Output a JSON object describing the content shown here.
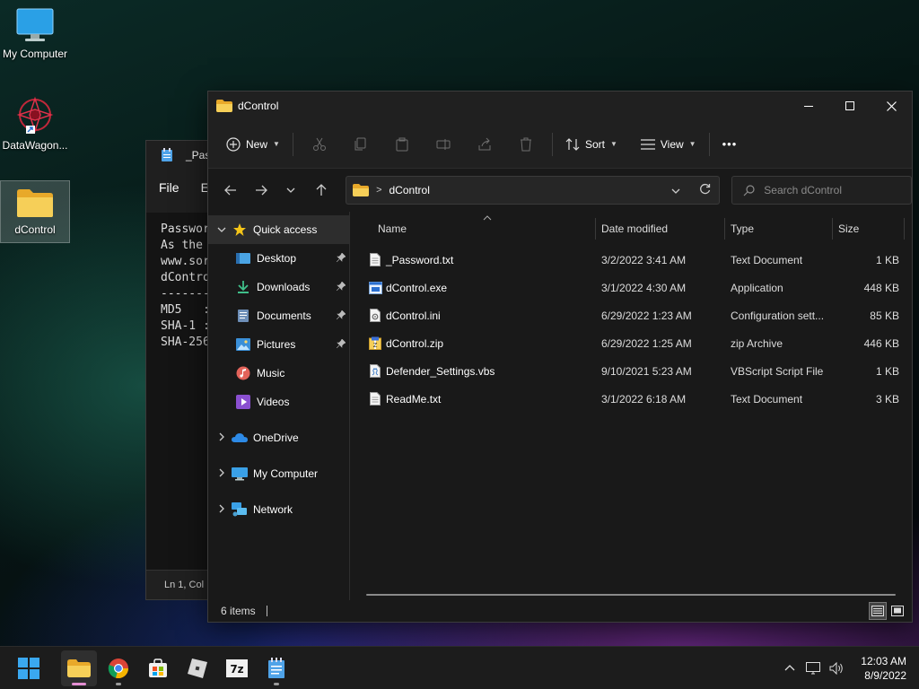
{
  "desktop": {
    "icons": [
      {
        "label": "My Computer"
      },
      {
        "label": "DataWagon..."
      },
      {
        "label": "dControl"
      }
    ]
  },
  "notepad": {
    "title": "_Pas",
    "menu_file": "File",
    "menu_edit": "E",
    "text_lines": [
      "Passwor",
      "",
      "As the ",
      "",
      "www.sor",
      "",
      "dContro",
      "-------",
      "MD5   :",
      "SHA-1 :",
      "SHA-256"
    ],
    "status": "Ln 1, Col"
  },
  "explorer": {
    "title": "dControl",
    "toolbar": {
      "new_label": "New",
      "sort_label": "Sort",
      "view_label": "View",
      "more_label": "•••"
    },
    "address": {
      "folder": "dControl"
    },
    "search": {
      "placeholder": "Search dControl"
    },
    "nav": {
      "quick_access": "Quick access",
      "pinned": [
        {
          "label": "Desktop"
        },
        {
          "label": "Downloads"
        },
        {
          "label": "Documents"
        },
        {
          "label": "Pictures"
        },
        {
          "label": "Music"
        },
        {
          "label": "Videos"
        }
      ],
      "onedrive": "OneDrive",
      "my_computer": "My Computer",
      "network": "Network"
    },
    "columns": {
      "name": "Name",
      "date": "Date modified",
      "type": "Type",
      "size": "Size"
    },
    "files": [
      {
        "name": "_Password.txt",
        "date": "3/2/2022 3:41 AM",
        "type": "Text Document",
        "size": "1 KB"
      },
      {
        "name": "dControl.exe",
        "date": "3/1/2022 4:30 AM",
        "type": "Application",
        "size": "448 KB"
      },
      {
        "name": "dControl.ini",
        "date": "6/29/2022 1:23 AM",
        "type": "Configuration sett...",
        "size": "85 KB"
      },
      {
        "name": "dControl.zip",
        "date": "6/29/2022 1:25 AM",
        "type": "zip Archive",
        "size": "446 KB"
      },
      {
        "name": "Defender_Settings.vbs",
        "date": "9/10/2021 5:23 AM",
        "type": "VBScript Script File",
        "size": "1 KB"
      },
      {
        "name": "ReadMe.txt",
        "date": "3/1/2022 6:18 AM",
        "type": "Text Document",
        "size": "3 KB"
      }
    ],
    "status": {
      "count": "6 items"
    }
  },
  "taskbar": {
    "clock_time": "12:03 AM",
    "clock_date": "8/9/2022"
  },
  "colors": {
    "folder": "#f4c64e",
    "accent": "#4cc2ff",
    "active_indicator": "#e38ed2"
  }
}
